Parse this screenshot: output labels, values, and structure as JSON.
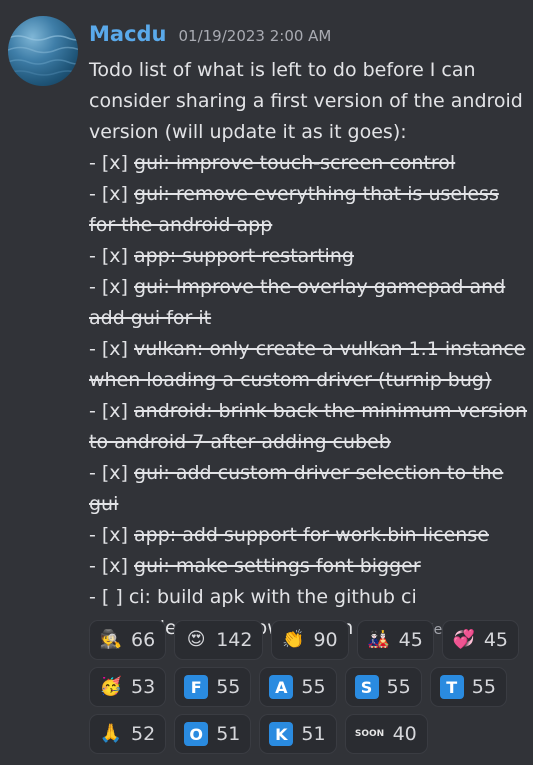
{
  "message": {
    "username": "Macdu",
    "timestamp": "01/19/2023 2:00 AM",
    "intro": "Todo list of what is left to do before I can consider sharing a first version of the android version (will update it as it goes):",
    "items": [
      {
        "checkbox": "- [x]",
        "text": "gui: improve touch-screen control",
        "done": true
      },
      {
        "checkbox": "- [x]",
        "text": "gui: remove everything that is useless for the android app",
        "done": true
      },
      {
        "checkbox": "- [x]",
        "text": "app: support restarting",
        "done": true
      },
      {
        "checkbox": "- [x]",
        "text": "gui: Improve the overlay gamepad and add gui for it",
        "done": true
      },
      {
        "checkbox": "- [x]",
        "text": "vulkan: only create a vulkan 1.1 instance when loading a custom driver (turnip bug)",
        "done": true
      },
      {
        "checkbox": "- [x]",
        "text": "android: brink back the minimum version to android 7 after adding cubeb",
        "done": true
      },
      {
        "checkbox": "- [x]",
        "text": "gui: add custom driver selection to the gui",
        "done": true
      },
      {
        "checkbox": "- [x]",
        "text": "app: add support for work.bin license",
        "done": true
      },
      {
        "checkbox": "- [x]",
        "text": "gui: make settings font bigger",
        "done": true
      },
      {
        "checkbox": "- [ ]",
        "text": "ci: build apk with the github ci",
        "done": false
      },
      {
        "checkbox": "- [ ]",
        "text": "understand how to sign an apk",
        "done": false
      }
    ],
    "edited_label": "(edited)"
  },
  "reactions": [
    {
      "emoji": "detective-icon",
      "glyph": "🕵",
      "count": "66"
    },
    {
      "emoji": "heart-eyes-icon",
      "glyph": "😍",
      "count": "142"
    },
    {
      "emoji": "clapping-hands-icon",
      "glyph": "👏",
      "count": "90"
    },
    {
      "emoji": "anime-character-icon",
      "glyph": "🎎",
      "count": "45"
    },
    {
      "emoji": "rainbow-hearts-icon",
      "glyph": "💞",
      "count": "45"
    },
    {
      "emoji": "party-face-icon",
      "glyph": "🥳",
      "count": "53"
    },
    {
      "emoji": "letter-f-tile",
      "letter": "F",
      "count": "55"
    },
    {
      "emoji": "letter-a-tile",
      "letter": "A",
      "count": "55"
    },
    {
      "emoji": "letter-s-tile",
      "letter": "S",
      "count": "55"
    },
    {
      "emoji": "letter-t-tile",
      "letter": "T",
      "count": "55"
    },
    {
      "emoji": "folded-hands-icon",
      "glyph": "🙏",
      "count": "52"
    },
    {
      "emoji": "letter-o-tile",
      "letter": "O",
      "count": "51"
    },
    {
      "emoji": "letter-k-tile",
      "letter": "K",
      "count": "51"
    },
    {
      "emoji": "soon-icon",
      "glyph": "SOON",
      "count": "40"
    }
  ],
  "colors": {
    "background": "#313338",
    "username": "#5aa9ea",
    "letter_tile": "#2a8be0"
  }
}
